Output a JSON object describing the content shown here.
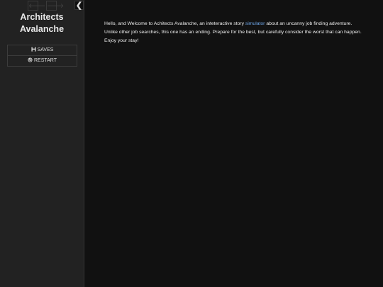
{
  "sidebar": {
    "history": {
      "back_glyph": "🡐",
      "forward_glyph": "🡒",
      "back_icon": "arrow-left-icon",
      "forward_icon": "arrow-right-icon"
    },
    "stow_glyph": "❮",
    "title_line1": "Architects",
    "title_line2": "Avalanche",
    "menu": {
      "saves_label": "SAVES",
      "restart_label": "RESTART"
    }
  },
  "passage": {
    "line1_before": "Hello, and Welcome to Achitects Avalanche, an inteteractive story ",
    "line1_link": "simulator",
    "line1_after": " about an uncanny job finding adventure.",
    "line2": "Unlike other job searches, this one has an ending. Prepare for the best, but carefully consider the worst that can happen.",
    "line3": "Enjoy your stay!"
  },
  "colors": {
    "sidebar_bg": "#222222",
    "main_bg": "#111111",
    "link": "#6ea6e8",
    "text": "#eeeeee"
  }
}
